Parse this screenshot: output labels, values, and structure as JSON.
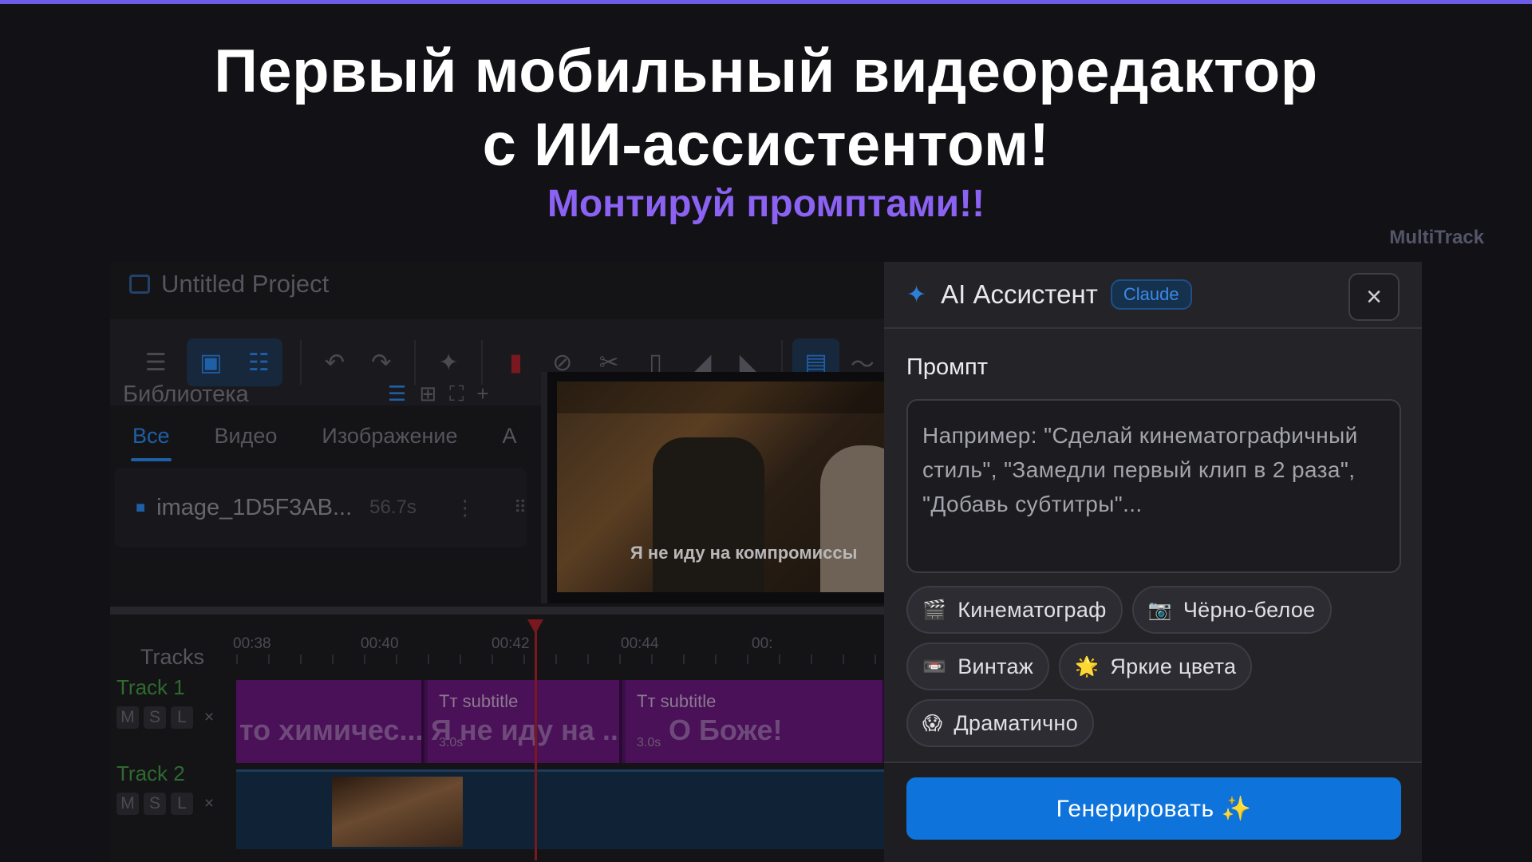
{
  "headline": {
    "line1": "Первый мобильный видеоредактор",
    "line2": "с ИИ-ассистентом!",
    "subtitle": "Монтируй промптами!!",
    "brand": "MultiTrack"
  },
  "editor": {
    "project_title": "Untitled Project",
    "library": {
      "title": "Библиотека",
      "tabs": [
        "Все",
        "Видео",
        "Изображение",
        "А"
      ],
      "items": [
        {
          "name": "image_1D5F3AB...",
          "duration": "56.7s"
        }
      ]
    },
    "preview": {
      "subtitle_text": "Я не иду на компромиссы"
    },
    "timeline": {
      "tracks_label": "Tracks",
      "ticks": [
        "00:38",
        "00:40",
        "00:42",
        "00:44",
        "00:"
      ],
      "tracks": [
        {
          "name": "Track 1",
          "buttons": [
            "M",
            "S",
            "L",
            "×"
          ],
          "clips": [
            {
              "title": "",
              "text": "то химичес...",
              "duration": ""
            },
            {
              "title": "subtitle",
              "text": "Я не иду на ...",
              "duration": "3.0s"
            },
            {
              "title": "subtitle",
              "text": "О Боже!",
              "duration": "3.0s"
            }
          ]
        },
        {
          "name": "Track 2",
          "buttons": [
            "M",
            "S",
            "L",
            "×"
          ]
        }
      ]
    }
  },
  "ai_panel": {
    "title": "AI Ассистент",
    "badge": "Claude",
    "close_icon": "×",
    "prompt_label": "Промпт",
    "prompt_placeholder": "Например: \"Сделай кинематографичный стиль\", \"Замедли первый клип в 2 раза\", \"Добавь субтитры\"...",
    "chips": [
      {
        "emoji": "🎬",
        "label": "Кинематограф"
      },
      {
        "emoji": "📷",
        "label": "Чёрно-белое"
      },
      {
        "emoji": "📼",
        "label": "Винтаж"
      },
      {
        "emoji": "🌟",
        "label": "Яркие цвета"
      },
      {
        "emoji": "😱",
        "label": "Драматично"
      }
    ],
    "generate_label": "Генерировать ✨"
  },
  "colors": {
    "accent_purple": "#8b62f2",
    "accent_blue": "#0e74dc",
    "background": "#111116"
  }
}
